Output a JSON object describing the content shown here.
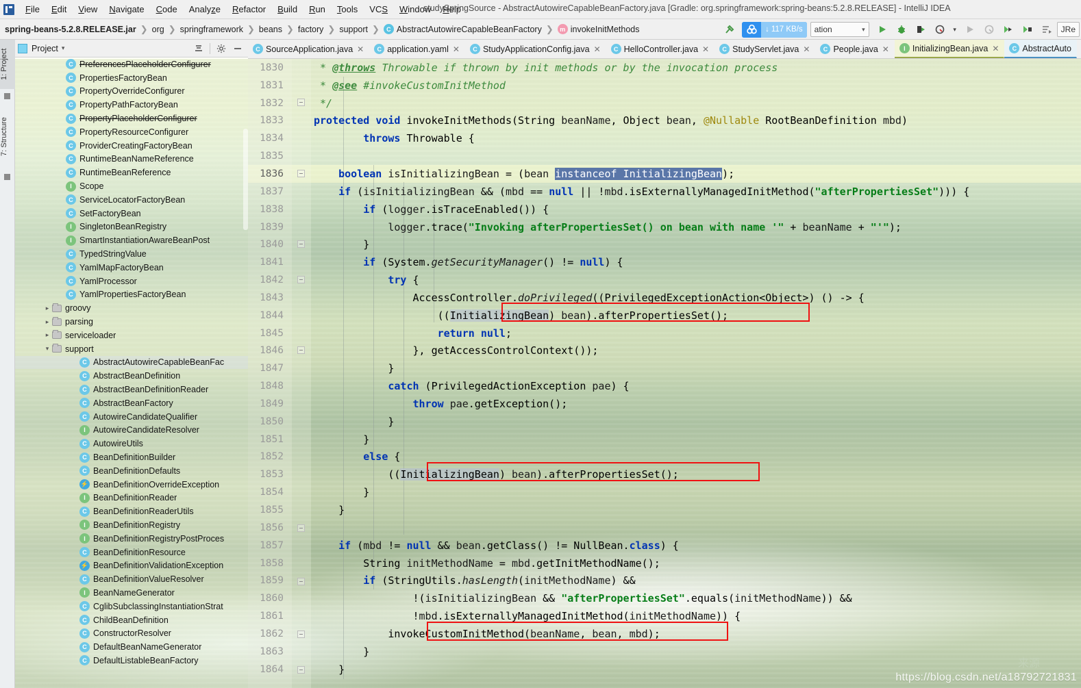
{
  "window": {
    "title": "studySpringSource - AbstractAutowireCapableBeanFactory.java [Gradle: org.springframework:spring-beans:5.2.8.RELEASE] - IntelliJ IDEA",
    "logo_icon": "intellij-idea-logo"
  },
  "menu": [
    {
      "label": "File"
    },
    {
      "label": "Edit"
    },
    {
      "label": "View"
    },
    {
      "label": "Navigate"
    },
    {
      "label": "Code"
    },
    {
      "label": "Analyze"
    },
    {
      "label": "Refactor"
    },
    {
      "label": "Build"
    },
    {
      "label": "Run"
    },
    {
      "label": "Tools"
    },
    {
      "label": "VCS"
    },
    {
      "label": "Window"
    },
    {
      "label": "Help"
    }
  ],
  "breadcrumb": [
    {
      "label": "spring-beans-5.2.8.RELEASE.jar",
      "bold": true,
      "badge": ""
    },
    {
      "label": "org",
      "bold": false,
      "badge": ""
    },
    {
      "label": "springframework",
      "bold": false,
      "badge": ""
    },
    {
      "label": "beans",
      "bold": false,
      "badge": ""
    },
    {
      "label": "factory",
      "bold": false,
      "badge": ""
    },
    {
      "label": "support",
      "bold": false,
      "badge": ""
    },
    {
      "label": "AbstractAutowireCapableBeanFactory",
      "bold": false,
      "badge": "c"
    },
    {
      "label": "invokeInitMethods",
      "bold": false,
      "badge": "m"
    }
  ],
  "toolbar": {
    "build_icon": "hammer-icon",
    "network_speed": "117 KB/s",
    "network_icon": "netspeed-cloud-icon",
    "download_arrow": "download-arrow-icon",
    "run_config_label": "ation",
    "run_config_chevron": "chevron-down-icon",
    "run_icon": "run-play-icon",
    "debug_icon": "debug-bug-icon",
    "run_with_coverage_icon": "run-coverage-icon",
    "profile_icon": "profile-icon",
    "profile_chevron": "chevron-down-icon",
    "rerun_icon": "rerun-play-icon",
    "attach_icon": "attach-process-icon",
    "update_app_icon": "update-running-app-icon",
    "rerun_app_icon": "rerun-app-icon",
    "stacktrace_icon": "analyze-stacktrace-icon",
    "jre_label": "JRe"
  },
  "left_tool_tabs": [
    {
      "label": "1: Project",
      "active": true
    },
    {
      "label": "7: Structure",
      "active": false
    }
  ],
  "project_panel": {
    "title": "Project",
    "cube_icon": "project-cube-icon",
    "chevron_icon": "chevron-down-icon",
    "collapse_all_icon": "collapse-all-icon",
    "settings_icon": "gear-icon",
    "hide_icon": "minimize-icon",
    "tree": [
      {
        "label": "PreferencesPlaceholderConfigurer",
        "icon": "class",
        "indent": 3,
        "strike": true,
        "arrow": "",
        "selected": false
      },
      {
        "label": "PropertiesFactoryBean",
        "icon": "class",
        "indent": 3,
        "strike": false,
        "arrow": "",
        "selected": false
      },
      {
        "label": "PropertyOverrideConfigurer",
        "icon": "class",
        "indent": 3,
        "strike": false,
        "arrow": "",
        "selected": false
      },
      {
        "label": "PropertyPathFactoryBean",
        "icon": "class",
        "indent": 3,
        "strike": false,
        "arrow": "",
        "selected": false
      },
      {
        "label": "PropertyPlaceholderConfigurer",
        "icon": "class",
        "indent": 3,
        "strike": true,
        "arrow": "",
        "selected": false
      },
      {
        "label": "PropertyResourceConfigurer",
        "icon": "class",
        "indent": 3,
        "strike": false,
        "arrow": "",
        "selected": false
      },
      {
        "label": "ProviderCreatingFactoryBean",
        "icon": "class",
        "indent": 3,
        "strike": false,
        "arrow": "",
        "selected": false
      },
      {
        "label": "RuntimeBeanNameReference",
        "icon": "class",
        "indent": 3,
        "strike": false,
        "arrow": "",
        "selected": false
      },
      {
        "label": "RuntimeBeanReference",
        "icon": "class",
        "indent": 3,
        "strike": false,
        "arrow": "",
        "selected": false
      },
      {
        "label": "Scope",
        "icon": "interface",
        "indent": 3,
        "strike": false,
        "arrow": "",
        "selected": false
      },
      {
        "label": "ServiceLocatorFactoryBean",
        "icon": "class",
        "indent": 3,
        "strike": false,
        "arrow": "",
        "selected": false
      },
      {
        "label": "SetFactoryBean",
        "icon": "class",
        "indent": 3,
        "strike": false,
        "arrow": "",
        "selected": false
      },
      {
        "label": "SingletonBeanRegistry",
        "icon": "interface",
        "indent": 3,
        "strike": false,
        "arrow": "",
        "selected": false
      },
      {
        "label": "SmartInstantiationAwareBeanPost",
        "icon": "interface",
        "indent": 3,
        "strike": false,
        "arrow": "",
        "selected": false
      },
      {
        "label": "TypedStringValue",
        "icon": "class",
        "indent": 3,
        "strike": false,
        "arrow": "",
        "selected": false
      },
      {
        "label": "YamlMapFactoryBean",
        "icon": "class",
        "indent": 3,
        "strike": false,
        "arrow": "",
        "selected": false
      },
      {
        "label": "YamlProcessor",
        "icon": "class",
        "indent": 3,
        "strike": false,
        "arrow": "",
        "selected": false
      },
      {
        "label": "YamlPropertiesFactoryBean",
        "icon": "class",
        "indent": 3,
        "strike": false,
        "arrow": "",
        "selected": false
      },
      {
        "label": "groovy",
        "icon": "folder",
        "indent": 2,
        "strike": false,
        "arrow": "right",
        "selected": false
      },
      {
        "label": "parsing",
        "icon": "folder",
        "indent": 2,
        "strike": false,
        "arrow": "right",
        "selected": false
      },
      {
        "label": "serviceloader",
        "icon": "folder",
        "indent": 2,
        "strike": false,
        "arrow": "right",
        "selected": false
      },
      {
        "label": "support",
        "icon": "folder",
        "indent": 2,
        "strike": false,
        "arrow": "down",
        "selected": false
      },
      {
        "label": "AbstractAutowireCapableBeanFac",
        "icon": "class",
        "indent": 4,
        "strike": false,
        "arrow": "",
        "selected": true
      },
      {
        "label": "AbstractBeanDefinition",
        "icon": "class",
        "indent": 4,
        "strike": false,
        "arrow": "",
        "selected": false
      },
      {
        "label": "AbstractBeanDefinitionReader",
        "icon": "class",
        "indent": 4,
        "strike": false,
        "arrow": "",
        "selected": false
      },
      {
        "label": "AbstractBeanFactory",
        "icon": "class",
        "indent": 4,
        "strike": false,
        "arrow": "",
        "selected": false
      },
      {
        "label": "AutowireCandidateQualifier",
        "icon": "class",
        "indent": 4,
        "strike": false,
        "arrow": "",
        "selected": false
      },
      {
        "label": "AutowireCandidateResolver",
        "icon": "interface",
        "indent": 4,
        "strike": false,
        "arrow": "",
        "selected": false
      },
      {
        "label": "AutowireUtils",
        "icon": "class",
        "indent": 4,
        "strike": false,
        "arrow": "",
        "selected": false
      },
      {
        "label": "BeanDefinitionBuilder",
        "icon": "class",
        "indent": 4,
        "strike": false,
        "arrow": "",
        "selected": false
      },
      {
        "label": "BeanDefinitionDefaults",
        "icon": "class",
        "indent": 4,
        "strike": false,
        "arrow": "",
        "selected": false
      },
      {
        "label": "BeanDefinitionOverrideException",
        "icon": "exception",
        "indent": 4,
        "strike": false,
        "arrow": "",
        "selected": false
      },
      {
        "label": "BeanDefinitionReader",
        "icon": "interface",
        "indent": 4,
        "strike": false,
        "arrow": "",
        "selected": false
      },
      {
        "label": "BeanDefinitionReaderUtils",
        "icon": "class",
        "indent": 4,
        "strike": false,
        "arrow": "",
        "selected": false
      },
      {
        "label": "BeanDefinitionRegistry",
        "icon": "interface",
        "indent": 4,
        "strike": false,
        "arrow": "",
        "selected": false
      },
      {
        "label": "BeanDefinitionRegistryPostProces",
        "icon": "interface",
        "indent": 4,
        "strike": false,
        "arrow": "",
        "selected": false
      },
      {
        "label": "BeanDefinitionResource",
        "icon": "class",
        "indent": 4,
        "strike": false,
        "arrow": "",
        "selected": false
      },
      {
        "label": "BeanDefinitionValidationException",
        "icon": "exception",
        "indent": 4,
        "strike": false,
        "arrow": "",
        "selected": false
      },
      {
        "label": "BeanDefinitionValueResolver",
        "icon": "class",
        "indent": 4,
        "strike": false,
        "arrow": "",
        "selected": false
      },
      {
        "label": "BeanNameGenerator",
        "icon": "interface",
        "indent": 4,
        "strike": false,
        "arrow": "",
        "selected": false
      },
      {
        "label": "CglibSubclassingInstantiationStrat",
        "icon": "class",
        "indent": 4,
        "strike": false,
        "arrow": "",
        "selected": false
      },
      {
        "label": "ChildBeanDefinition",
        "icon": "class",
        "indent": 4,
        "strike": false,
        "arrow": "",
        "selected": false
      },
      {
        "label": "ConstructorResolver",
        "icon": "class",
        "indent": 4,
        "strike": false,
        "arrow": "",
        "selected": false
      },
      {
        "label": "DefaultBeanNameGenerator",
        "icon": "class",
        "indent": 4,
        "strike": false,
        "arrow": "",
        "selected": false
      },
      {
        "label": "DefaultListableBeanFactory",
        "icon": "class",
        "indent": 4,
        "strike": false,
        "arrow": "",
        "selected": false
      }
    ]
  },
  "editor_tabs": [
    {
      "label": "SourceApplication.java",
      "icon": "spring-class-icon",
      "state": "normal",
      "closable": true
    },
    {
      "label": "application.yaml",
      "icon": "spring-yaml-icon",
      "state": "normal",
      "closable": true
    },
    {
      "label": "StudyApplicationConfig.java",
      "icon": "class-icon",
      "state": "normal",
      "closable": true
    },
    {
      "label": "HelloController.java",
      "icon": "class-icon",
      "state": "normal",
      "closable": true
    },
    {
      "label": "StudyServlet.java",
      "icon": "class-icon",
      "state": "normal",
      "closable": true
    },
    {
      "label": "People.java",
      "icon": "class-icon",
      "state": "normal",
      "closable": true
    },
    {
      "label": "InitializingBean.java",
      "icon": "interface-icon",
      "state": "active",
      "closable": true
    },
    {
      "label": "AbstractAuto",
      "icon": "class-readonly-icon",
      "state": "current",
      "closable": false
    }
  ],
  "editor": {
    "first_line": 1830,
    "lines": [
      {
        "n": 1830,
        "text": " * @throws Throwable if thrown by init methods or by the invocation process"
      },
      {
        "n": 1831,
        "text": " * @see #invokeCustomInitMethod"
      },
      {
        "n": 1832,
        "text": " */"
      },
      {
        "n": 1833,
        "text": "protected void invokeInitMethods(String beanName, Object bean, @Nullable RootBeanDefinition mbd)"
      },
      {
        "n": 1834,
        "text": "        throws Throwable {"
      },
      {
        "n": 1835,
        "text": ""
      },
      {
        "n": 1836,
        "text": "    boolean isInitializingBean = (bean instanceof InitializingBean);"
      },
      {
        "n": 1837,
        "text": "    if (isInitializingBean && (mbd == null || !mbd.isExternallyManagedInitMethod(\"afterPropertiesSet\"))) {"
      },
      {
        "n": 1838,
        "text": "        if (logger.isTraceEnabled()) {"
      },
      {
        "n": 1839,
        "text": "            logger.trace(\"Invoking afterPropertiesSet() on bean with name '\" + beanName + \"'\");"
      },
      {
        "n": 1840,
        "text": "        }"
      },
      {
        "n": 1841,
        "text": "        if (System.getSecurityManager() != null) {"
      },
      {
        "n": 1842,
        "text": "            try {"
      },
      {
        "n": 1843,
        "text": "                AccessController.doPrivileged((PrivilegedExceptionAction<Object>) () -> {"
      },
      {
        "n": 1844,
        "text": "                    ((InitializingBean) bean).afterPropertiesSet();"
      },
      {
        "n": 1845,
        "text": "                    return null;"
      },
      {
        "n": 1846,
        "text": "                }, getAccessControlContext());"
      },
      {
        "n": 1847,
        "text": "            }"
      },
      {
        "n": 1848,
        "text": "            catch (PrivilegedActionException pae) {"
      },
      {
        "n": 1849,
        "text": "                throw pae.getException();"
      },
      {
        "n": 1850,
        "text": "            }"
      },
      {
        "n": 1851,
        "text": "        }"
      },
      {
        "n": 1852,
        "text": "        else {"
      },
      {
        "n": 1853,
        "text": "            ((InitializingBean) bean).afterPropertiesSet();"
      },
      {
        "n": 1854,
        "text": "        }"
      },
      {
        "n": 1855,
        "text": "    }"
      },
      {
        "n": 1856,
        "text": ""
      },
      {
        "n": 1857,
        "text": "    if (mbd != null && bean.getClass() != NullBean.class) {"
      },
      {
        "n": 1858,
        "text": "        String initMethodName = mbd.getInitMethodName();"
      },
      {
        "n": 1859,
        "text": "        if (StringUtils.hasLength(initMethodName) &&"
      },
      {
        "n": 1860,
        "text": "                !(isInitializingBean && \"afterPropertiesSet\".equals(initMethodName)) &&"
      },
      {
        "n": 1861,
        "text": "                !mbd.isExternallyManagedInitMethod(initMethodName)) {"
      },
      {
        "n": 1862,
        "text": "            invokeCustomInitMethod(beanName, bean, mbd);"
      },
      {
        "n": 1863,
        "text": "        }"
      },
      {
        "n": 1864,
        "text": "    }"
      }
    ],
    "selection_text": "instanceof InitializingBean",
    "current_line": 1836,
    "annotations": [
      {
        "name": "red-highlight-box-1",
        "line": 1844,
        "text": "((InitializingBean) bean).afterPropertiesSet();"
      },
      {
        "name": "red-highlight-box-2",
        "line": 1853,
        "text": "((InitializingBean) bean).afterPropertiesSet();"
      },
      {
        "name": "red-highlight-box-3",
        "line": 1862,
        "text": "invokeCustomInitMethod(beanName, bean, mbd);"
      }
    ]
  },
  "watermark": {
    "text": "https://blog.csdn.net/a18792721831"
  },
  "colors": {
    "accent_blue": "#2f90ef",
    "highlight_red": "#ef1212",
    "keyword": "#0033b3",
    "string": "#067d17",
    "comment": "#3d8a3d",
    "field": "#871094",
    "selection": "#5a76a8"
  }
}
